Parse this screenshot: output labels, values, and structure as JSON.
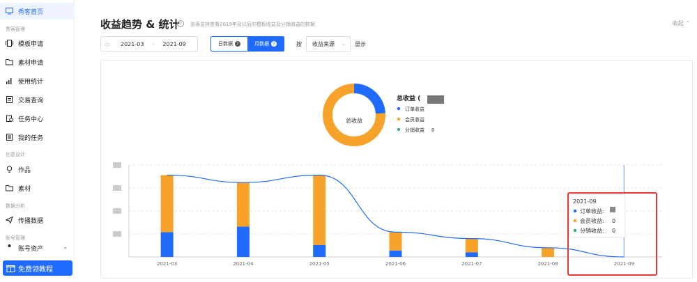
{
  "sidebar": {
    "top_item": "秀客首页",
    "groups": [
      {
        "label": "秀客管理",
        "items": [
          "模板申请",
          "素材申请",
          "使用统计",
          "交易查询",
          "任务中心",
          "我的任务"
        ]
      },
      {
        "label": "创意设计",
        "items": [
          "作品",
          "素材"
        ]
      },
      {
        "label": "数据分析",
        "items": [
          "传播数据"
        ]
      },
      {
        "label": "账号管理",
        "items": [
          "账号资产"
        ]
      }
    ],
    "promo": "免费领教程"
  },
  "header": {
    "title": "收益趋势 & 统计",
    "subtitle": "该表支持查看2019年及以后的模板收益及分销收益的数据",
    "collapse": "收起"
  },
  "filters": {
    "start": "2021-03",
    "sep": "-",
    "end": "2021-09",
    "day_tab": "日数据",
    "month_tab": "月数据",
    "by_label": "按",
    "source_select": "收益来源",
    "show_label": "显示"
  },
  "donut": {
    "center_label": "总收益",
    "total_label": "总收益 (",
    "legend": [
      {
        "name": "订单收益",
        "value": "",
        "color": "#1f6bff"
      },
      {
        "name": "会员收益",
        "value": "",
        "color": "#f7a22b"
      },
      {
        "name": "分销收益",
        "value": "0",
        "color": "#3ab07b"
      }
    ],
    "share_order": 0.24
  },
  "chart_data": {
    "type": "bar",
    "categories": [
      "2021-03",
      "2021-04",
      "2021-05",
      "2021-06",
      "2021-07",
      "2021-08",
      "2021-09"
    ],
    "series": [
      {
        "name": "订单收益",
        "values": [
          0.27,
          0.33,
          0.13,
          0.07,
          0.05,
          0.0,
          0.0
        ],
        "color": "#1f6bff"
      },
      {
        "name": "会员收益",
        "values": [
          0.62,
          0.48,
          0.76,
          0.2,
          0.15,
          0.1,
          0.0
        ],
        "color": "#f7a22b"
      },
      {
        "name": "分销收益",
        "values": [
          0,
          0,
          0,
          0,
          0,
          0,
          0
        ],
        "color": "#3ab07b"
      }
    ],
    "line_values": [
      0.89,
      0.81,
      0.89,
      0.27,
      0.2,
      0.1,
      0.0
    ],
    "ylim": [
      0,
      1
    ],
    "grid": true,
    "line_color": "#1f6bff"
  },
  "tooltip": {
    "title": "2021-09",
    "rows": [
      {
        "label": "订单收益:",
        "value": "",
        "color": "#1f6bff"
      },
      {
        "label": "会员收益:",
        "value": "0",
        "color": "#f7a22b"
      },
      {
        "label": "分销收益:",
        "value": "0",
        "color": "#3ab07b"
      }
    ],
    "highlight_color": "#e53935"
  }
}
